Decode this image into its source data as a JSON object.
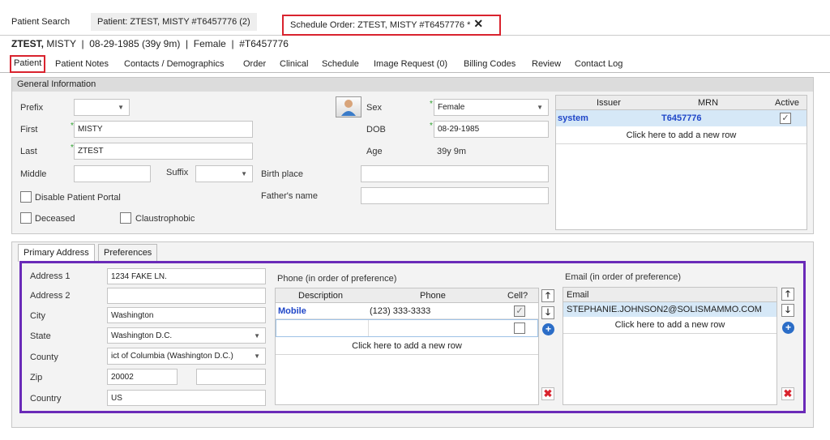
{
  "doc_tabs": [
    {
      "label": "Patient Search"
    },
    {
      "label": "Patient: ZTEST, MISTY #T6457776 (2)"
    },
    {
      "label": "Schedule Order: ZTEST, MISTY #T6457776 *",
      "close": "✕"
    }
  ],
  "header": {
    "last": "ZTEST,",
    "rest": " MISTY  |  08-29-1985 (39y 9m)  |  Female  |  #T6457776"
  },
  "patient_tabs": [
    "Patient",
    "Patient Notes",
    "Contacts / Demographics",
    "Order",
    "Clinical",
    "Schedule",
    "Image Request (0)",
    "Billing Codes",
    "Review",
    "Contact Log"
  ],
  "general": {
    "title": "General Information",
    "prefix_label": "Prefix",
    "prefix_value": "",
    "first_label": "First",
    "first_value": "MISTY",
    "last_label": "Last",
    "last_value": "ZTEST",
    "middle_label": "Middle",
    "middle_value": "",
    "suffix_label": "Suffix",
    "suffix_value": "",
    "birthplace_label": "Birth place",
    "birthplace_value": "",
    "father_label": "Father's name",
    "father_value": "",
    "sex_label": "Sex",
    "sex_value": "Female",
    "dob_label": "DOB",
    "dob_value": "08-29-1985",
    "age_label": "Age",
    "age_value": "39y 9m",
    "disable_portal": "Disable Patient Portal",
    "deceased": "Deceased",
    "claustrophobic": "Claustrophobic"
  },
  "issuer_grid": {
    "headers": [
      "Issuer",
      "MRN",
      "Active"
    ],
    "row": {
      "issuer": "system",
      "mrn": "T6457776",
      "active": true
    },
    "add_row": "Click here to add a new row"
  },
  "sub_tabs": [
    "Primary Address",
    "Preferences"
  ],
  "address": {
    "address1_label": "Address 1",
    "address1_value": "1234 FAKE LN.",
    "address2_label": "Address 2",
    "address2_value": "",
    "city_label": "City",
    "city_value": "Washington",
    "state_label": "State",
    "state_value": "Washington D.C.",
    "county_label": "County",
    "county_value": "ict of Columbia (Washington D.C.)",
    "zip_label": "Zip",
    "zip_value": "20002",
    "zip_ext": "",
    "country_label": "Country",
    "country_value": "US"
  },
  "phone": {
    "title": "Phone (in order of preference)",
    "headers": [
      "Description",
      "Phone",
      "Cell?"
    ],
    "row": {
      "description": "Mobile",
      "phone": "(123) 333-3333",
      "cell": true
    },
    "add_row": "Click here to add a new row"
  },
  "email": {
    "title": "Email (in order of preference)",
    "header": "Email",
    "row": "STEPHANIE.JOHNSON2@SOLISMAMMO.COM",
    "add_row": "Click here to add a new row"
  },
  "icons": {
    "up": "🡑",
    "down": "🡓",
    "plus": "+",
    "delete": "✖",
    "check": "✓",
    "dropdown": "▼"
  }
}
